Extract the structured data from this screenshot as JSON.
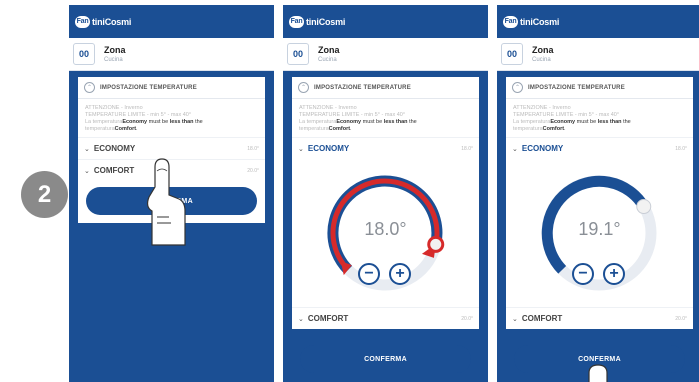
{
  "step_number": "2",
  "app": {
    "logo_mark": "Fan",
    "logo_text": "tiniCosmi"
  },
  "zone": {
    "icon_text": "00",
    "title": "Zona",
    "subtitle": "Cucina"
  },
  "settings": {
    "section_title": "IMPOSTAZIONE TEMPERATURE",
    "note_line1": "ATTENZIONE - Inverno",
    "note_line2": "TEMPERATURE LIMITE - min 5° - max 40°",
    "note_prefix": "La temperatura",
    "note_economy": "Economy",
    "note_must": " must be ",
    "note_less": "less than",
    "note_the": " the",
    "note_prefix2": "temperatura",
    "note_comfort": "Comfort",
    "note_period": "."
  },
  "rows": {
    "economy": {
      "label": "ECONOMY",
      "value": "18.0°"
    },
    "comfort": {
      "label": "COMFORT",
      "value": "20.0°"
    }
  },
  "confirm_label": "CONFERMA",
  "dials": [
    {
      "value_text": "18.0°",
      "fraction": 0.88
    },
    {
      "value_text": "19.1°",
      "fraction": 0.72
    }
  ],
  "icons": {
    "minus": "−",
    "plus": "+",
    "chevron": "⌄",
    "chevron_up": "⌃"
  },
  "colors": {
    "primary": "#1b4f94",
    "accent": "#d62a2a",
    "badge": "#8a8a8a"
  }
}
